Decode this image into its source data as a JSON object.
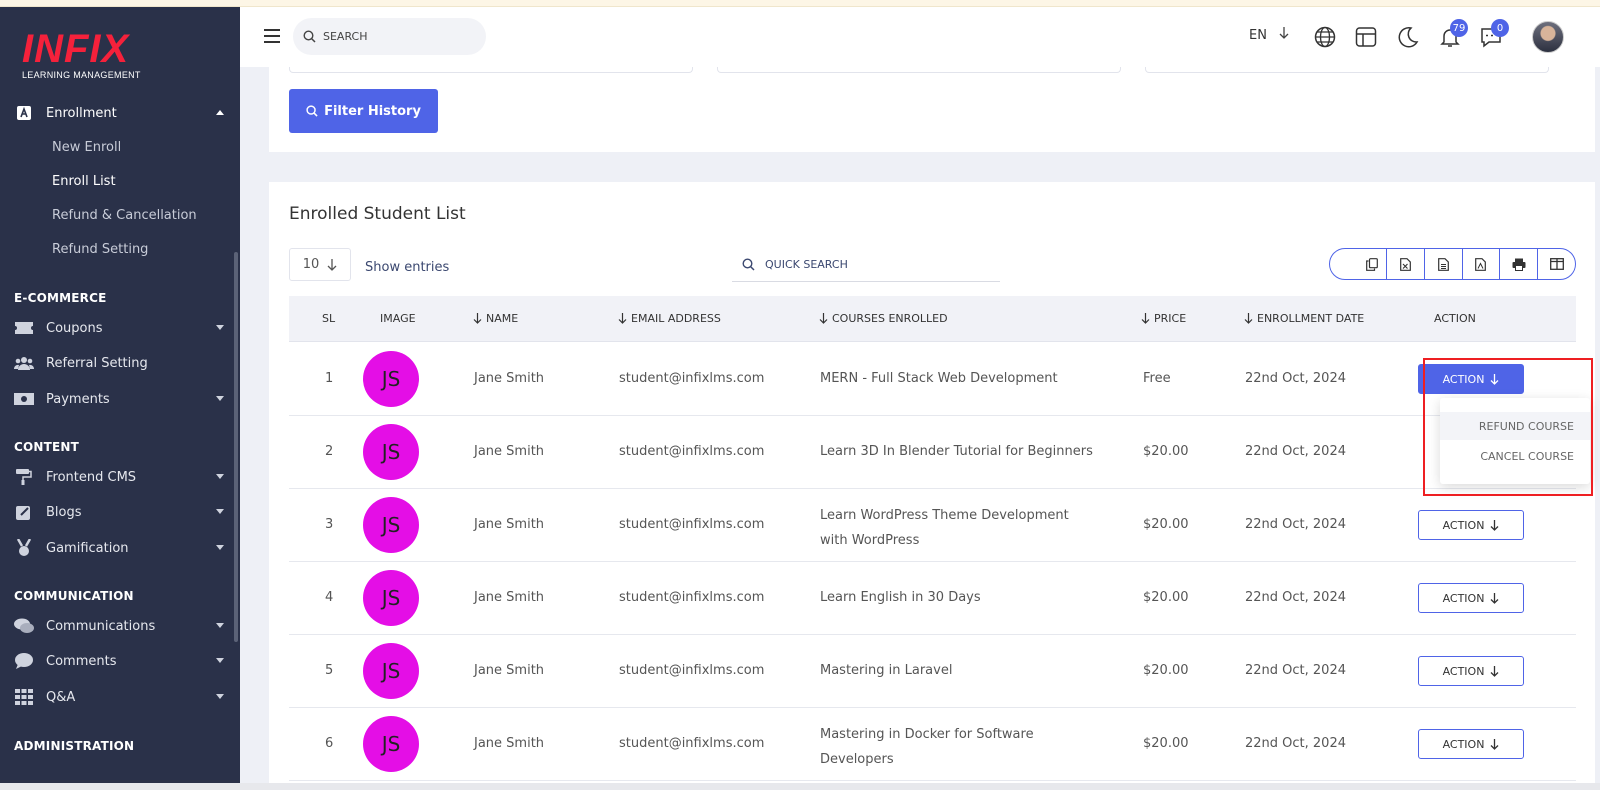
{
  "app": {
    "logo_text": "INFIX",
    "logo_subtitle": "LEARNING MANAGEMENT"
  },
  "header": {
    "search_placeholder": "SEARCH",
    "language": "EN",
    "notifications_count": "79",
    "messages_count": "0"
  },
  "sidebar": {
    "enrollment": {
      "label": "Enrollment",
      "items": [
        "New Enroll",
        "Enroll List",
        "Refund & Cancellation",
        "Refund Setting"
      ]
    },
    "sections": [
      {
        "title": "E-COMMERCE",
        "items": [
          "Coupons",
          "Referral Setting",
          "Payments"
        ]
      },
      {
        "title": "CONTENT",
        "items": [
          "Frontend CMS",
          "Blogs",
          "Gamification"
        ]
      },
      {
        "title": "COMMUNICATION",
        "items": [
          "Communications",
          "Comments",
          "Q&A"
        ]
      },
      {
        "title": "ADMINISTRATION",
        "items": []
      }
    ]
  },
  "filter": {
    "button_label": "Filter History"
  },
  "list": {
    "title": "Enrolled Student List",
    "entries_value": "10",
    "entries_label": "Show entries",
    "quick_search_placeholder": "QUICK SEARCH",
    "columns": [
      "SL",
      "IMAGE",
      "NAME",
      "EMAIL ADDRESS",
      "COURSES ENROLLED",
      "PRICE",
      "ENROLLMENT DATE",
      "ACTION"
    ],
    "action_label": "ACTION",
    "rows": [
      {
        "sl": "1",
        "initials": "JS",
        "name": "Jane Smith",
        "email": "student@infixlms.com",
        "course": "MERN - Full Stack Web Development",
        "price": "Free",
        "date": "22nd Oct, 2024"
      },
      {
        "sl": "2",
        "initials": "JS",
        "name": "Jane Smith",
        "email": "student@infixlms.com",
        "course": "Learn 3D In Blender Tutorial for Beginners",
        "price": "$20.00",
        "date": "22nd Oct, 2024"
      },
      {
        "sl": "3",
        "initials": "JS",
        "name": "Jane Smith",
        "email": "student@infixlms.com",
        "course": "Learn WordPress Theme Development with WordPress",
        "price": "$20.00",
        "date": "22nd Oct, 2024"
      },
      {
        "sl": "4",
        "initials": "JS",
        "name": "Jane Smith",
        "email": "student@infixlms.com",
        "course": "Learn English in 30 Days",
        "price": "$20.00",
        "date": "22nd Oct, 2024"
      },
      {
        "sl": "5",
        "initials": "JS",
        "name": "Jane Smith",
        "email": "student@infixlms.com",
        "course": "Mastering in Laravel",
        "price": "$20.00",
        "date": "22nd Oct, 2024"
      },
      {
        "sl": "6",
        "initials": "JS",
        "name": "Jane Smith",
        "email": "student@infixlms.com",
        "course": "Mastering in Docker for Software Developers",
        "price": "$20.00",
        "date": "22nd Oct, 2024"
      }
    ],
    "dropdown": [
      "REFUND COURSE",
      "CANCEL COURSE"
    ]
  },
  "colors": {
    "accent": "#4f64e7",
    "sidebar_bg": "#2a3149",
    "avatar_bg": "#e40ee6",
    "highlight": "#ee1f22",
    "logo_red": "#f5213b"
  },
  "icons": [
    "menu-icon",
    "search-icon",
    "globe-icon",
    "layout-icon",
    "moon-icon",
    "bell-icon",
    "chat-icon",
    "copy-icon",
    "excel-icon",
    "csv-icon",
    "pdf-icon",
    "print-icon",
    "columns-icon"
  ]
}
